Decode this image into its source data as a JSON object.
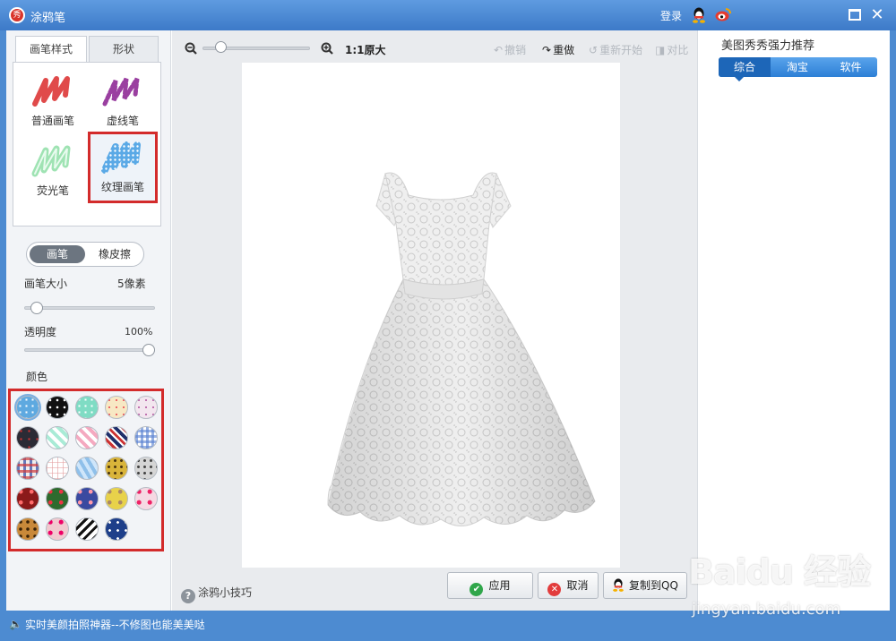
{
  "window": {
    "title": "涂鸦笔",
    "login": "登录"
  },
  "left": {
    "tabs": [
      {
        "label": "画笔样式",
        "active": true
      },
      {
        "label": "形状",
        "active": false
      }
    ],
    "brushes": [
      {
        "label": "普通画笔",
        "icon": "normal-brush-icon",
        "color": "#e04a4a"
      },
      {
        "label": "虚线笔",
        "icon": "dashed-brush-icon",
        "color": "#9a3fa0"
      },
      {
        "label": "荧光笔",
        "icon": "highlighter-brush-icon",
        "color": "#9fe3b3"
      },
      {
        "label": "纹理画笔",
        "icon": "texture-brush-icon",
        "color": "#5aa9e6",
        "selected": true
      }
    ],
    "mode": {
      "brush": "画笔",
      "eraser": "橡皮擦"
    },
    "size": {
      "label": "画笔大小",
      "value": "5像素",
      "level": 0.05
    },
    "opacity": {
      "label": "透明度",
      "value": "100%",
      "level": 1.0
    },
    "color_label": "颜色",
    "textures": [
      "blue-dots",
      "black-dots",
      "mint-dots",
      "cream-dots",
      "pink-sparkle",
      "dark-red-star",
      "mint-stripe",
      "pink-stripe",
      "navy-red-stripe",
      "blue-gingham",
      "red-plaid",
      "white-plaid",
      "blue-wave",
      "gold-leopard",
      "grey-leopard",
      "red-floral",
      "green-floral",
      "purple-floral",
      "yellow-floral",
      "pink-floral",
      "leopard",
      "rose-floral",
      "zebra",
      "blue-white-porcelain"
    ]
  },
  "toolbar": {
    "ratio": "1:1原大",
    "undo": "撤销",
    "redo": "重做",
    "restart": "重新开始",
    "compare": "对比",
    "zoom_level": 0.12
  },
  "bottom": {
    "tips": "涂鸦小技巧",
    "apply": "应用",
    "cancel": "取消",
    "copy_qq": "复制到QQ"
  },
  "right": {
    "title": "美图秀秀强力推荐",
    "tabs": [
      {
        "label": "综合",
        "active": true
      },
      {
        "label": "淘宝",
        "active": false
      },
      {
        "label": "软件",
        "active": false
      }
    ]
  },
  "status": {
    "text": "实时美颜拍照神器--不修图也能美美哒"
  },
  "watermark": {
    "brand": "Baidu 经验",
    "url": "jingyan.baidu.com"
  },
  "colors": {
    "accent": "#3d7ac8",
    "highlight": "#d32b2b",
    "selected_tab": "#1d66b8"
  }
}
